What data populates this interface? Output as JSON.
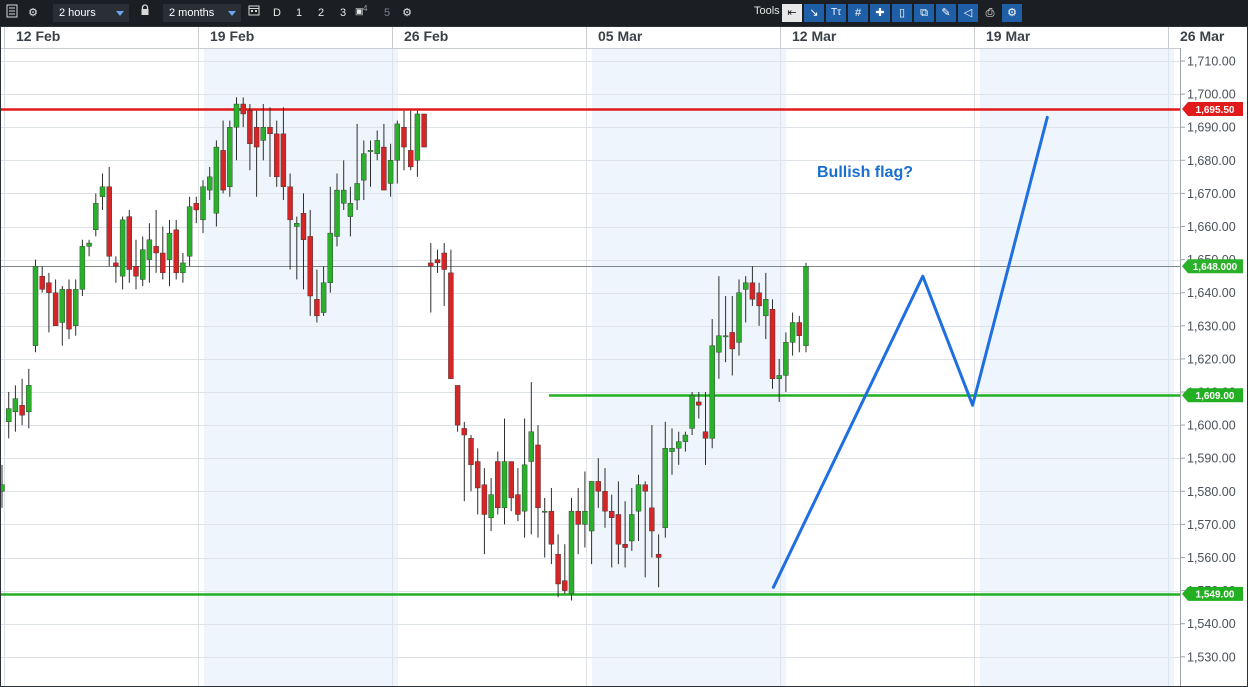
{
  "toolbar": {
    "interval_label": "2 hours",
    "range_label": "2 months",
    "btn_d": "D",
    "btn_1": "1",
    "btn_2": "2",
    "btn_3": "3",
    "btn_4": "4",
    "btn_5": "5",
    "tools_label": "Tools",
    "tool_icons": [
      "arrow-left-icon",
      "trendline-icon",
      "text-tool-icon",
      "grid-icon",
      "crosshair-icon",
      "candle-icon",
      "layers-icon",
      "pencil-icon",
      "shape-icon",
      "print-icon",
      "settings-tool-icon"
    ]
  },
  "chart_data": {
    "type": "candlestick",
    "instrument_price_last": "1,648.000",
    "x_labels": [
      "12 Feb",
      "19 Feb",
      "26 Feb",
      "05 Mar",
      "12 Mar",
      "19 Mar",
      "26 Mar"
    ],
    "y_ticks": [
      "1,710.00",
      "1,700.00",
      "1,690.00",
      "1,680.00",
      "1,670.00",
      "1,660.00",
      "1,650.00",
      "1,640.00",
      "1,630.00",
      "1,620.00",
      "1,610.00",
      "1,600.00",
      "1,590.00",
      "1,580.00",
      "1,570.00",
      "1,560.00",
      "1,550.00",
      "1,540.00",
      "1,530.00"
    ],
    "ylim": [
      1526,
      1713
    ],
    "horizontal_lines": [
      {
        "label": "1,695.50",
        "value": 1695.5,
        "color": "#e01b1b"
      },
      {
        "label": "1,609.00",
        "value": 1609,
        "color": "#22b022"
      },
      {
        "label": "1,549.00",
        "value": 1549,
        "color": "#22b022"
      }
    ],
    "current_price": {
      "label": "1,648.000",
      "value": 1648
    },
    "annotation": "Bullish flag?",
    "flag_path": [
      [
        46.5,
        1551
      ],
      [
        55.5,
        1645
      ],
      [
        58.5,
        1606
      ],
      [
        63,
        1693
      ]
    ],
    "colors": {
      "up": "#2bb02b",
      "down": "#d42626",
      "flag": "#1f6fe0",
      "annotation": "#1a6fd0",
      "band": "#eef5fc"
    },
    "candles": [
      {
        "o": 1580,
        "h": 1588,
        "l": 1575,
        "c": 1582
      },
      {
        "o": 1601,
        "h": 1610,
        "l": 1596,
        "c": 1605
      },
      {
        "o": 1604,
        "h": 1612,
        "l": 1598,
        "c": 1608
      },
      {
        "o": 1606,
        "h": 1614,
        "l": 1600,
        "c": 1603
      },
      {
        "o": 1604,
        "h": 1617,
        "l": 1599,
        "c": 1612
      },
      {
        "o": 1624,
        "h": 1650,
        "l": 1622,
        "c": 1648
      },
      {
        "o": 1645,
        "h": 1648,
        "l": 1640,
        "c": 1641
      },
      {
        "o": 1643,
        "h": 1646,
        "l": 1628,
        "c": 1640
      },
      {
        "o": 1640,
        "h": 1644,
        "l": 1632,
        "c": 1630
      },
      {
        "o": 1631,
        "h": 1642,
        "l": 1624,
        "c": 1641
      },
      {
        "o": 1641,
        "h": 1644,
        "l": 1626,
        "c": 1629
      },
      {
        "o": 1630,
        "h": 1644,
        "l": 1627,
        "c": 1641
      },
      {
        "o": 1641,
        "h": 1656,
        "l": 1639,
        "c": 1654
      },
      {
        "o": 1654,
        "h": 1656,
        "l": 1651,
        "c": 1655
      },
      {
        "o": 1659,
        "h": 1670,
        "l": 1657,
        "c": 1667
      },
      {
        "o": 1669,
        "h": 1676,
        "l": 1665,
        "c": 1672
      },
      {
        "o": 1672,
        "h": 1678,
        "l": 1648,
        "c": 1651
      },
      {
        "o": 1649,
        "h": 1651,
        "l": 1643,
        "c": 1648
      },
      {
        "o": 1645,
        "h": 1663,
        "l": 1641,
        "c": 1662
      },
      {
        "o": 1663,
        "h": 1665,
        "l": 1643,
        "c": 1647
      },
      {
        "o": 1648,
        "h": 1656,
        "l": 1641,
        "c": 1645
      },
      {
        "o": 1644,
        "h": 1657,
        "l": 1642,
        "c": 1653
      },
      {
        "o": 1650,
        "h": 1661,
        "l": 1643,
        "c": 1656
      },
      {
        "o": 1654,
        "h": 1665,
        "l": 1646,
        "c": 1652
      },
      {
        "o": 1652,
        "h": 1660,
        "l": 1644,
        "c": 1646
      },
      {
        "o": 1650,
        "h": 1662,
        "l": 1642,
        "c": 1658
      },
      {
        "o": 1659,
        "h": 1662,
        "l": 1644,
        "c": 1646
      },
      {
        "o": 1646,
        "h": 1652,
        "l": 1643,
        "c": 1649
      },
      {
        "o": 1651,
        "h": 1669,
        "l": 1648,
        "c": 1666
      },
      {
        "o": 1667,
        "h": 1669,
        "l": 1661,
        "c": 1665
      },
      {
        "o": 1662,
        "h": 1674,
        "l": 1658,
        "c": 1672
      },
      {
        "o": 1671,
        "h": 1678,
        "l": 1668,
        "c": 1675
      },
      {
        "o": 1664,
        "h": 1686,
        "l": 1660,
        "c": 1684
      },
      {
        "o": 1683,
        "h": 1692,
        "l": 1670,
        "c": 1671
      },
      {
        "o": 1672,
        "h": 1692,
        "l": 1669,
        "c": 1690
      },
      {
        "o": 1690,
        "h": 1699,
        "l": 1680,
        "c": 1697
      },
      {
        "o": 1697,
        "h": 1699,
        "l": 1690,
        "c": 1694
      },
      {
        "o": 1695,
        "h": 1697,
        "l": 1677,
        "c": 1685
      },
      {
        "o": 1690,
        "h": 1695,
        "l": 1669,
        "c": 1684
      },
      {
        "o": 1686,
        "h": 1697,
        "l": 1680,
        "c": 1690
      },
      {
        "o": 1690,
        "h": 1696,
        "l": 1675,
        "c": 1688
      },
      {
        "o": 1688,
        "h": 1692,
        "l": 1672,
        "c": 1675
      },
      {
        "o": 1688,
        "h": 1696,
        "l": 1668,
        "c": 1672
      },
      {
        "o": 1672,
        "h": 1676,
        "l": 1647,
        "c": 1662
      },
      {
        "o": 1660,
        "h": 1663,
        "l": 1644,
        "c": 1661
      },
      {
        "o": 1664,
        "h": 1670,
        "l": 1641,
        "c": 1656
      },
      {
        "o": 1657,
        "h": 1665,
        "l": 1633,
        "c": 1639
      },
      {
        "o": 1638,
        "h": 1647,
        "l": 1631,
        "c": 1633
      },
      {
        "o": 1634,
        "h": 1648,
        "l": 1633,
        "c": 1643
      },
      {
        "o": 1643,
        "h": 1672,
        "l": 1640,
        "c": 1658
      },
      {
        "o": 1657,
        "h": 1676,
        "l": 1654,
        "c": 1671
      },
      {
        "o": 1667,
        "h": 1680,
        "l": 1665,
        "c": 1671
      },
      {
        "o": 1663,
        "h": 1672,
        "l": 1657,
        "c": 1667
      },
      {
        "o": 1668,
        "h": 1691,
        "l": 1665,
        "c": 1673
      },
      {
        "o": 1674,
        "h": 1686,
        "l": 1668,
        "c": 1682
      },
      {
        "o": 1683,
        "h": 1686,
        "l": 1672,
        "c": 1683
      },
      {
        "o": 1682,
        "h": 1689,
        "l": 1680,
        "c": 1686
      },
      {
        "o": 1684,
        "h": 1691,
        "l": 1675,
        "c": 1671
      },
      {
        "o": 1673,
        "h": 1685,
        "l": 1669,
        "c": 1680
      },
      {
        "o": 1680,
        "h": 1692,
        "l": 1673,
        "c": 1691
      },
      {
        "o": 1690,
        "h": 1695,
        "l": 1677,
        "c": 1684
      },
      {
        "o": 1683,
        "h": 1695,
        "l": 1677,
        "c": 1678
      },
      {
        "o": 1680,
        "h": 1695,
        "l": 1675,
        "c": 1694
      },
      {
        "o": 1694,
        "h": 1694,
        "l": 1684,
        "c": 1684
      },
      {
        "o": 1649,
        "h": 1655,
        "l": 1634,
        "c": 1648
      },
      {
        "o": 1650,
        "h": 1653,
        "l": 1646,
        "c": 1649
      },
      {
        "o": 1652,
        "h": 1655,
        "l": 1636,
        "c": 1647
      },
      {
        "o": 1646,
        "h": 1653,
        "l": 1623,
        "c": 1614
      },
      {
        "o": 1612,
        "h": 1612,
        "l": 1598,
        "c": 1600
      },
      {
        "o": 1599,
        "h": 1601,
        "l": 1577,
        "c": 1597
      },
      {
        "o": 1596,
        "h": 1597,
        "l": 1580,
        "c": 1588
      },
      {
        "o": 1589,
        "h": 1593,
        "l": 1573,
        "c": 1581
      },
      {
        "o": 1582,
        "h": 1587,
        "l": 1561,
        "c": 1573
      },
      {
        "o": 1572,
        "h": 1584,
        "l": 1568,
        "c": 1579
      },
      {
        "o": 1589,
        "h": 1592,
        "l": 1573,
        "c": 1575
      },
      {
        "o": 1575,
        "h": 1602,
        "l": 1570,
        "c": 1589
      },
      {
        "o": 1589,
        "h": 1589,
        "l": 1574,
        "c": 1578
      },
      {
        "o": 1579,
        "h": 1587,
        "l": 1571,
        "c": 1573
      },
      {
        "o": 1574,
        "h": 1602,
        "l": 1566,
        "c": 1588
      },
      {
        "o": 1589,
        "h": 1613,
        "l": 1567,
        "c": 1598
      },
      {
        "o": 1594,
        "h": 1600,
        "l": 1566,
        "c": 1575
      },
      {
        "o": 1574,
        "h": 1578,
        "l": 1560,
        "c": 1574
      },
      {
        "o": 1574,
        "h": 1581,
        "l": 1558,
        "c": 1564
      },
      {
        "o": 1561,
        "h": 1567,
        "l": 1548,
        "c": 1552
      },
      {
        "o": 1553,
        "h": 1564,
        "l": 1549,
        "c": 1550
      },
      {
        "o": 1549,
        "h": 1578,
        "l": 1547,
        "c": 1574
      },
      {
        "o": 1574,
        "h": 1581,
        "l": 1561,
        "c": 1570
      },
      {
        "o": 1570,
        "h": 1586,
        "l": 1563,
        "c": 1574
      },
      {
        "o": 1568,
        "h": 1583,
        "l": 1558,
        "c": 1583
      },
      {
        "o": 1583,
        "h": 1590,
        "l": 1575,
        "c": 1580
      },
      {
        "o": 1580,
        "h": 1587,
        "l": 1569,
        "c": 1574
      },
      {
        "o": 1574,
        "h": 1579,
        "l": 1557,
        "c": 1572
      },
      {
        "o": 1573,
        "h": 1583,
        "l": 1558,
        "c": 1564
      },
      {
        "o": 1564,
        "h": 1577,
        "l": 1557,
        "c": 1563
      },
      {
        "o": 1565,
        "h": 1581,
        "l": 1562,
        "c": 1573
      },
      {
        "o": 1574,
        "h": 1585,
        "l": 1565,
        "c": 1582
      },
      {
        "o": 1582,
        "h": 1583,
        "l": 1554,
        "c": 1580
      },
      {
        "o": 1575,
        "h": 1600,
        "l": 1560,
        "c": 1568
      },
      {
        "o": 1561,
        "h": 1567,
        "l": 1551,
        "c": 1560
      },
      {
        "o": 1569,
        "h": 1601,
        "l": 1566,
        "c": 1593
      },
      {
        "o": 1592,
        "h": 1599,
        "l": 1585,
        "c": 1593
      },
      {
        "o": 1593,
        "h": 1598,
        "l": 1588,
        "c": 1595
      },
      {
        "o": 1595,
        "h": 1598,
        "l": 1592,
        "c": 1597
      },
      {
        "o": 1599,
        "h": 1610,
        "l": 1597,
        "c": 1609
      },
      {
        "o": 1607,
        "h": 1610,
        "l": 1602,
        "c": 1606
      },
      {
        "o": 1598,
        "h": 1610,
        "l": 1588,
        "c": 1596
      },
      {
        "o": 1596,
        "h": 1632,
        "l": 1593,
        "c": 1624
      },
      {
        "o": 1622,
        "h": 1645,
        "l": 1614,
        "c": 1627
      },
      {
        "o": 1627,
        "h": 1639,
        "l": 1619,
        "c": 1627
      },
      {
        "o": 1628,
        "h": 1639,
        "l": 1615,
        "c": 1623
      },
      {
        "o": 1625,
        "h": 1644,
        "l": 1621,
        "c": 1640
      },
      {
        "o": 1641,
        "h": 1645,
        "l": 1631,
        "c": 1643
      },
      {
        "o": 1643,
        "h": 1648,
        "l": 1636,
        "c": 1638
      },
      {
        "o": 1640,
        "h": 1643,
        "l": 1630,
        "c": 1636
      },
      {
        "o": 1633,
        "h": 1646,
        "l": 1626,
        "c": 1638
      },
      {
        "o": 1635,
        "h": 1638,
        "l": 1611,
        "c": 1614
      },
      {
        "o": 1614,
        "h": 1620,
        "l": 1607,
        "c": 1615
      },
      {
        "o": 1615,
        "h": 1628,
        "l": 1610,
        "c": 1625
      },
      {
        "o": 1625,
        "h": 1634,
        "l": 1621,
        "c": 1631
      },
      {
        "o": 1631,
        "h": 1633,
        "l": 1622,
        "c": 1627
      },
      {
        "o": 1624,
        "h": 1649,
        "l": 1622,
        "c": 1648
      }
    ]
  }
}
